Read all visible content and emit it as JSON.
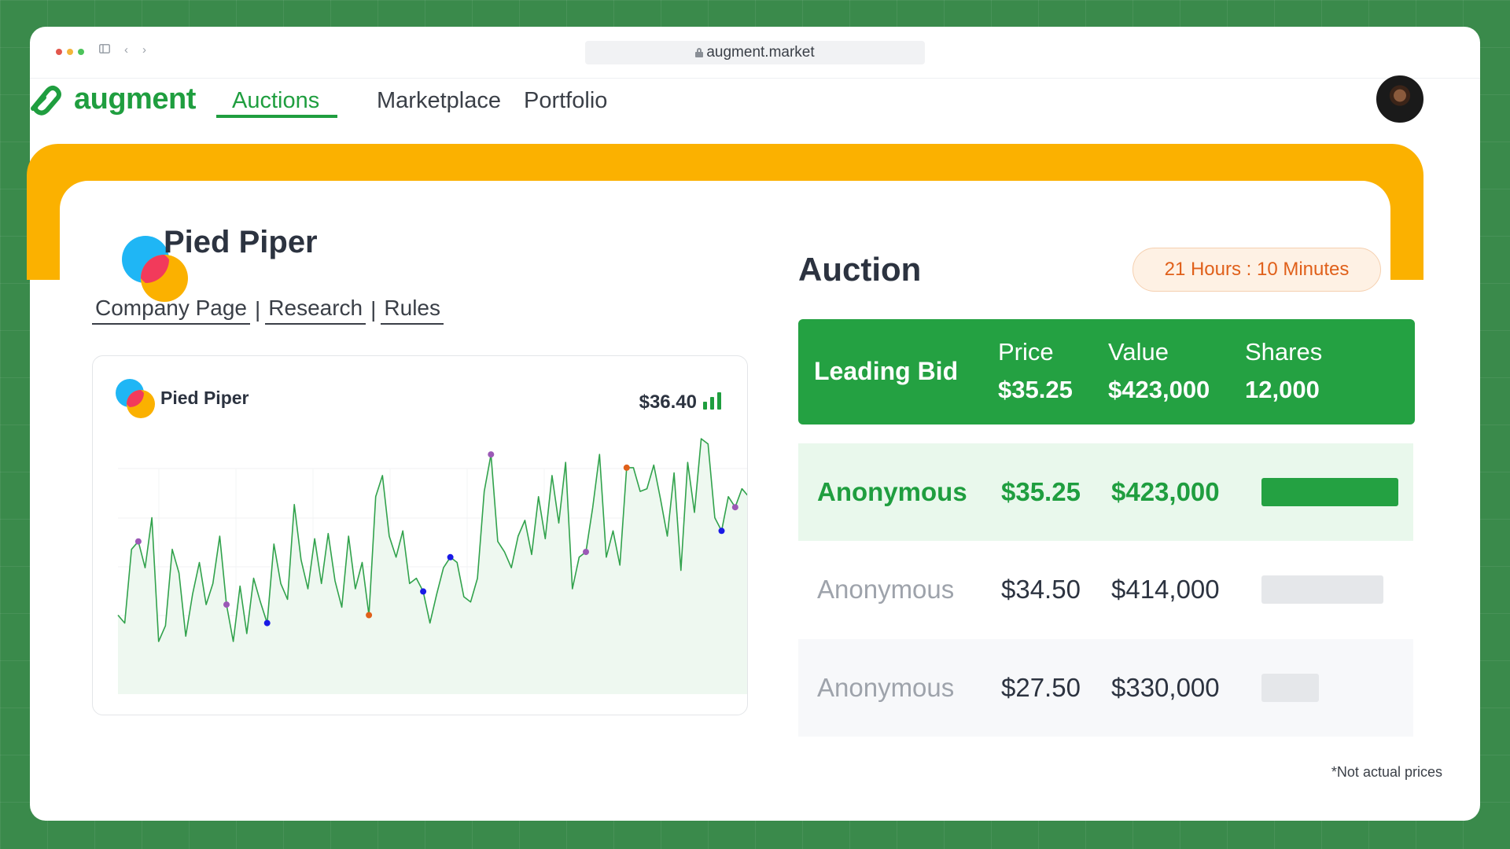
{
  "browser": {
    "url": "augment.market",
    "dot_colors": [
      "#e2574c",
      "#f3b53a",
      "#4cc35a"
    ]
  },
  "nav": {
    "logo_text": "augment",
    "items": [
      {
        "label": "Auctions",
        "active": true
      },
      {
        "label": "Marketplace",
        "active": false
      },
      {
        "label": "Portfolio",
        "active": false
      }
    ]
  },
  "company": {
    "name": "Pied Piper",
    "links": [
      "Company Page",
      "Research",
      "Rules"
    ]
  },
  "chart": {
    "name": "Pied Piper",
    "price": "$36.40",
    "line_color": "#31a24c"
  },
  "chart_data": {
    "type": "line",
    "title": "Pied Piper",
    "xlabel": "",
    "ylabel": "",
    "ylim": [
      0,
      100
    ],
    "grid": true,
    "series": [
      {
        "values": [
          30,
          27,
          55,
          58,
          48,
          67,
          20,
          26,
          55,
          46,
          22,
          38,
          50,
          34,
          42,
          60,
          34,
          20,
          41,
          23,
          44,
          35,
          27,
          57,
          42,
          36,
          72,
          51,
          40,
          59,
          42,
          61,
          43,
          33,
          60,
          40,
          50,
          30,
          75,
          83,
          60,
          52,
          62,
          42,
          44,
          39,
          27,
          38,
          48,
          52,
          50,
          37,
          35,
          44,
          77,
          91,
          58,
          54,
          48,
          60,
          66,
          53,
          75,
          59,
          83,
          65,
          88,
          40,
          52,
          54,
          71,
          91,
          52,
          62,
          49,
          86,
          86,
          77,
          78,
          87,
          74,
          60,
          84,
          47,
          88,
          69,
          97,
          95,
          67,
          62,
          75,
          71,
          78,
          75
        ]
      }
    ],
    "markers": [
      {
        "index": 3,
        "color": "#9b59b6"
      },
      {
        "index": 16,
        "color": "#9b59b6"
      },
      {
        "index": 22,
        "color": "#1a1ae6"
      },
      {
        "index": 37,
        "color": "#e0601a"
      },
      {
        "index": 45,
        "color": "#1a1ae6"
      },
      {
        "index": 49,
        "color": "#1a1ae6"
      },
      {
        "index": 55,
        "color": "#9b59b6"
      },
      {
        "index": 69,
        "color": "#9b59b6"
      },
      {
        "index": 75,
        "color": "#e0601a"
      },
      {
        "index": 89,
        "color": "#1a1ae6"
      },
      {
        "index": 91,
        "color": "#9b59b6"
      }
    ]
  },
  "auction": {
    "title": "Auction",
    "timer": "21 Hours : 10 Minutes",
    "leading": {
      "label": "Leading Bid",
      "price_label": "Price",
      "price": "$35.25",
      "value_label": "Value",
      "value": "$423,000",
      "shares_label": "Shares",
      "shares": "12,000"
    },
    "bids": [
      {
        "name": "Anonymous",
        "price": "$35.25",
        "value": "$423,000",
        "share_fraction": 1.0
      },
      {
        "name": "Anonymous",
        "price": "$34.50",
        "value": "$414,000",
        "share_fraction": 0.89
      },
      {
        "name": "Anonymous",
        "price": "$27.50",
        "value": "$330,000",
        "share_fraction": 0.42
      }
    ]
  },
  "footnote": "*Not actual prices",
  "colors": {
    "brand_green": "#1f9e3f",
    "accent_yellow": "#fbb100",
    "timer_orange": "#e0601a",
    "bar_muted": "#e5e7ea"
  }
}
